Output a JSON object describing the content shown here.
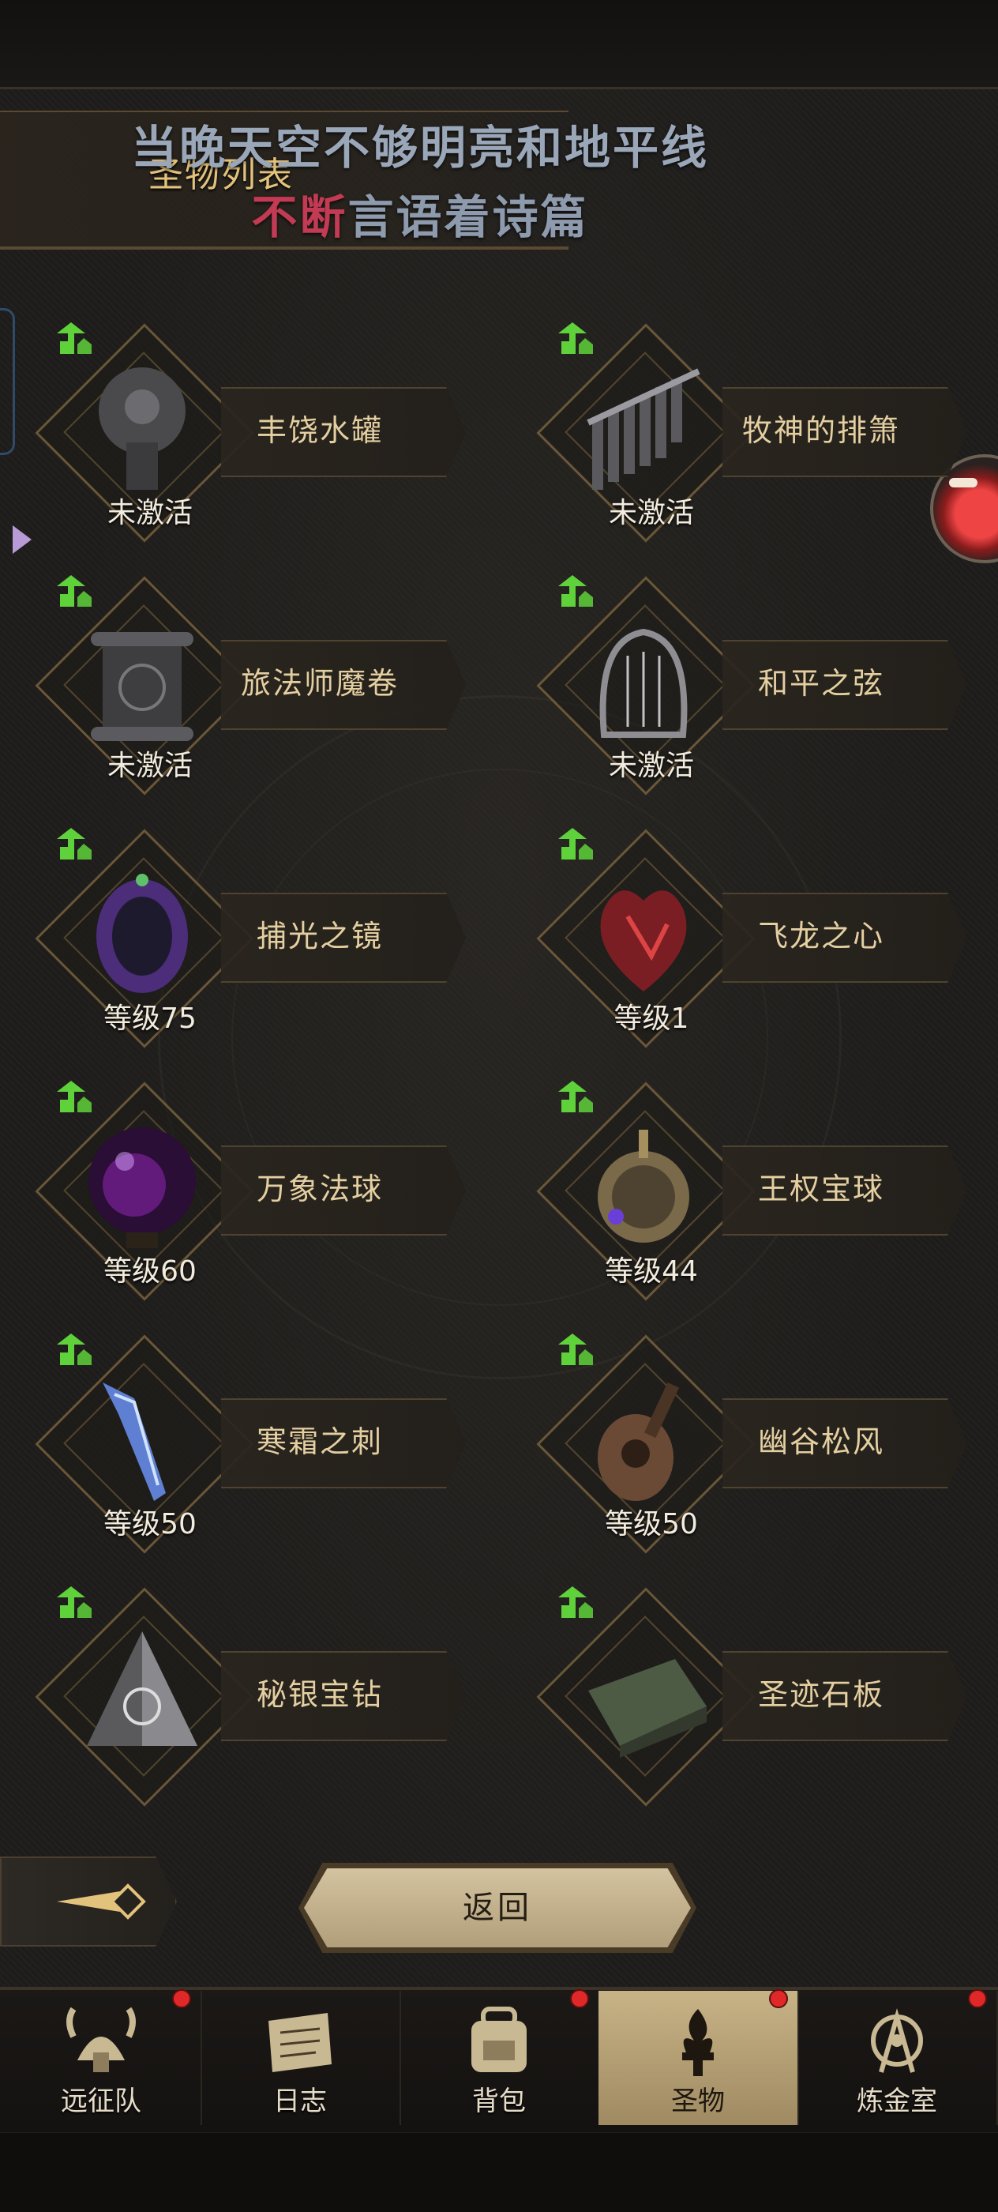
{
  "header": {
    "title": "圣物列表",
    "lyric_line1": "当晚天空不够明亮和地平线",
    "lyric_line2_highlight": "不断",
    "lyric_line2_rest": "言语着诗篇"
  },
  "relics": [
    {
      "name": "丰饶水罐",
      "status": "未激活",
      "icon": "urn-icon"
    },
    {
      "name": "牧神的排箫",
      "status": "未激活",
      "icon": "pan-flute-icon"
    },
    {
      "name": "旅法师魔卷",
      "status": "未激活",
      "icon": "scroll-icon"
    },
    {
      "name": "和平之弦",
      "status": "未激活",
      "icon": "lyre-icon"
    },
    {
      "name": "捕光之镜",
      "status": "等级75",
      "icon": "mirror-icon"
    },
    {
      "name": "飞龙之心",
      "status": "等级1",
      "icon": "dragon-heart-icon"
    },
    {
      "name": "万象法球",
      "status": "等级60",
      "icon": "orb-icon"
    },
    {
      "name": "王权宝球",
      "status": "等级44",
      "icon": "royal-orb-icon"
    },
    {
      "name": "寒霜之刺",
      "status": "等级50",
      "icon": "frost-shard-icon"
    },
    {
      "name": "幽谷松风",
      "status": "等级50",
      "icon": "lute-icon"
    },
    {
      "name": "秘银宝钻",
      "status": "",
      "icon": "pyramid-gem-icon"
    },
    {
      "name": "圣迹石板",
      "status": "",
      "icon": "stone-tablet-icon"
    }
  ],
  "actions": {
    "return_label": "返回"
  },
  "tabs": [
    {
      "label": "远征队",
      "icon": "viking-helmet-icon",
      "badge": true
    },
    {
      "label": "日志",
      "icon": "journal-icon",
      "badge": false
    },
    {
      "label": "背包",
      "icon": "backpack-icon",
      "badge": true
    },
    {
      "label": "圣物",
      "icon": "brazier-icon",
      "badge": true,
      "active": true
    },
    {
      "label": "炼金室",
      "icon": "alchemy-icon",
      "badge": true
    }
  ],
  "colors": {
    "accent_gold": "#e3c27c",
    "lyric_highlight": "#c23a53",
    "upgrade_green": "#5fd13b",
    "badge_red": "#e02828"
  }
}
